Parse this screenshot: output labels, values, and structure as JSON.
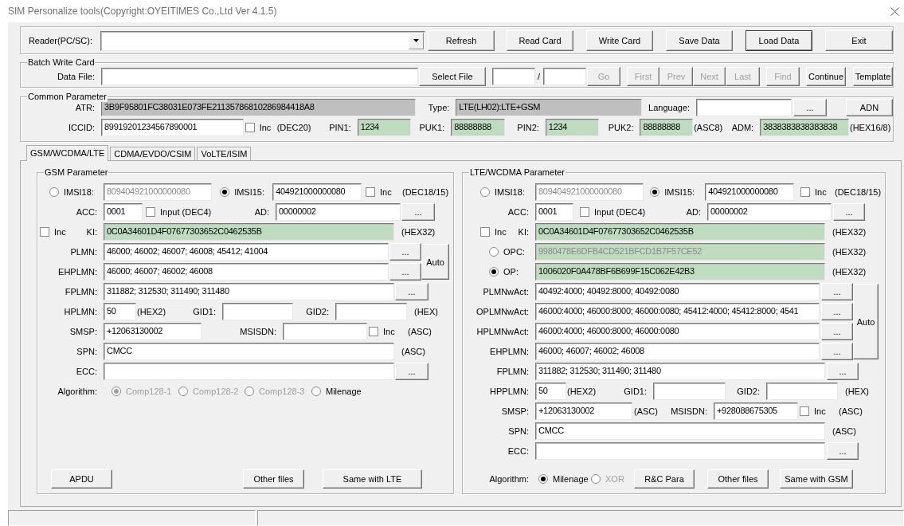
{
  "window": {
    "title": "SIM Personalize tools(Copyright:OYEITIMES Co.,Ltd Ver 4.1.5)"
  },
  "reader": {
    "rows": [
      {
        "items": [
          {
            "kind": "label",
            "text": "Reader(PC/SC):"
          },
          {
            "kind": "dropdown"
          },
          {
            "kind": "button",
            "label": "Refresh",
            "disabled": false,
            "default": false
          },
          {
            "kind": "button",
            "label": "Read Card",
            "disabled": false,
            "default": false
          },
          {
            "kind": "button",
            "label": "Write Card",
            "disabled": false,
            "default": false
          },
          {
            "kind": "button",
            "label": "Save Data",
            "disabled": false,
            "default": false
          },
          {
            "kind": "button",
            "label": "Load Data",
            "disabled": false,
            "default": true
          },
          {
            "kind": "button",
            "label": "Exit",
            "disabled": false,
            "default": false
          }
        ]
      }
    ]
  },
  "batch": {
    "legend": "Batch Write Card",
    "rows": [
      {
        "items": [
          {
            "kind": "label",
            "text": "Data File:"
          },
          {
            "kind": "field",
            "color": "#ffffff"
          },
          {
            "kind": "button",
            "label": "Select File",
            "disabled": false
          },
          {
            "kind": "field",
            "color": "#ffffff"
          },
          {
            "kind": "text",
            "text": "/"
          },
          {
            "kind": "field",
            "color": "#ffffff"
          },
          {
            "kind": "button",
            "label": "Go",
            "disabled": true
          },
          {
            "kind": "button",
            "label": "First",
            "disabled": true
          },
          {
            "kind": "button",
            "label": "Prev",
            "disabled": true
          },
          {
            "kind": "button",
            "label": "Next",
            "disabled": true
          },
          {
            "kind": "button",
            "label": "Last",
            "disabled": true
          },
          {
            "kind": "button",
            "label": "Find",
            "disabled": true
          },
          {
            "kind": "button",
            "label": "Continue",
            "disabled": false
          },
          {
            "kind": "button",
            "label": "Template",
            "disabled": false
          }
        ]
      }
    ]
  },
  "common": {
    "legend": "Common Parameter",
    "rows": [
      {
        "items": [
          {
            "kind": "label",
            "text": "ATR:"
          },
          {
            "kind": "field",
            "value": "3B9F95801FC38031E073FE21135786810286984418A8",
            "color": "#bfbfbf",
            "disabled": false
          },
          {
            "kind": "label",
            "text": "Type:"
          },
          {
            "kind": "field",
            "value": "LTE(LH02):LTE+GSM",
            "color": "#bfbfbf",
            "disabled": false
          },
          {
            "kind": "label",
            "text": "Language:"
          },
          {
            "kind": "field",
            "color": "#ffffff"
          },
          {
            "kind": "button",
            "label": "...",
            "disabled": false
          },
          {
            "kind": "button",
            "label": "ADN",
            "disabled": false
          }
        ]
      },
      {
        "items": [
          {
            "kind": "label",
            "text": "ICCID:"
          },
          {
            "kind": "field",
            "value": "89919201234567890001",
            "color": "#ffffff",
            "disabled": false
          },
          {
            "kind": "check",
            "label": "Inc",
            "checked": false
          },
          {
            "kind": "text",
            "text": "(DEC20)"
          },
          {
            "kind": "label",
            "text": "PIN1:"
          },
          {
            "kind": "field",
            "value": "1234",
            "color": "#c0dcc0",
            "disabled": false
          },
          {
            "kind": "label",
            "text": "PUK1:"
          },
          {
            "kind": "field",
            "value": "88888888",
            "color": "#c0dcc0",
            "disabled": false
          },
          {
            "kind": "label",
            "text": "PIN2:"
          },
          {
            "kind": "field",
            "value": "1234",
            "color": "#c0dcc0",
            "disabled": false
          },
          {
            "kind": "label",
            "text": "PUK2:"
          },
          {
            "kind": "field",
            "value": "88888888",
            "color": "#c0dcc0",
            "disabled": false
          },
          {
            "kind": "text",
            "text": "(ASC8)"
          },
          {
            "kind": "label",
            "text": "ADM:"
          },
          {
            "kind": "field",
            "value": "3838383838383838",
            "color": "#c0dcc0",
            "disabled": false
          },
          {
            "kind": "text",
            "text": "(HEX16/8)"
          }
        ]
      }
    ]
  },
  "tabs": [
    {
      "label": "GSM/WCDMA/LTE",
      "selected": true
    },
    {
      "label": "CDMA/EVDO/CSIM",
      "selected": false
    },
    {
      "label": "VoLTE/ISIM",
      "selected": false
    }
  ],
  "gsm": {
    "legend": "GSM Parameter",
    "rows": [
      {
        "items": [
          {
            "kind": "radio",
            "label": "IMSI18:",
            "selected": false,
            "disabled": false
          },
          {
            "kind": "field",
            "value": "809404921000000080",
            "color": "#ffffff",
            "disabled": true
          },
          {
            "kind": "radio",
            "label": "IMSI15:",
            "selected": true,
            "disabled": false
          },
          {
            "kind": "field",
            "value": "404921000000080",
            "color": "#ffffff",
            "disabled": false
          },
          {
            "kind": "check",
            "label": "Inc",
            "checked": false
          },
          {
            "kind": "text",
            "text": "(DEC18/15)"
          }
        ]
      },
      {
        "items": [
          {
            "kind": "label",
            "text": "ACC:"
          },
          {
            "kind": "field",
            "value": "0001",
            "color": "#ffffff",
            "disabled": false
          },
          {
            "kind": "check",
            "label": "Input (DEC4)",
            "checked": false
          },
          {
            "kind": "label",
            "text": "AD:"
          },
          {
            "kind": "field",
            "value": "00000002",
            "color": "#ffffff",
            "disabled": false
          },
          {
            "kind": "button",
            "label": "...",
            "disabled": false
          }
        ]
      },
      {
        "items": [
          {
            "kind": "check",
            "label": "Inc",
            "checked": false
          },
          {
            "kind": "label",
            "text": "KI:"
          },
          {
            "kind": "field",
            "value": "0C0A34601D4F07677303652C0462535B",
            "color": "#c0dcc0",
            "disabled": false
          },
          {
            "kind": "text",
            "text": "(HEX32)"
          }
        ]
      },
      {
        "kind": "stack",
        "rows": [
          {
            "items": [
              {
                "kind": "label",
                "text": "PLMN:"
              },
              {
                "kind": "field",
                "value": "46000; 46002; 46007; 46008; 45412; 41004",
                "color": "#ffffff",
                "disabled": false
              },
              {
                "kind": "button",
                "label": "...",
                "disabled": false
              }
            ]
          },
          {
            "items": [
              {
                "kind": "label",
                "text": "EHPLMN:"
              },
              {
                "kind": "field",
                "value": "46000; 46007; 46002; 46008",
                "color": "#ffffff",
                "disabled": false
              },
              {
                "kind": "button",
                "label": "...",
                "disabled": false
              }
            ]
          }
        ],
        "button": {
          "label": "Auto",
          "disabled": false
        }
      },
      {
        "items": [
          {
            "kind": "label",
            "text": "FPLMN:"
          },
          {
            "kind": "field",
            "value": "311882; 312530; 311490; 311480",
            "color": "#ffffff",
            "disabled": false
          },
          {
            "kind": "button",
            "label": "...",
            "disabled": false
          }
        ]
      },
      {
        "items": [
          {
            "kind": "label",
            "text": "HPLMN:"
          },
          {
            "kind": "field",
            "value": "50",
            "color": "#ffffff",
            "disabled": false
          },
          {
            "kind": "text",
            "text": "(HEX2)"
          },
          {
            "kind": "label",
            "text": "GID1:"
          },
          {
            "kind": "field",
            "color": "#ffffff"
          },
          {
            "kind": "label",
            "text": "GID2:"
          },
          {
            "kind": "field",
            "color": "#ffffff"
          },
          {
            "kind": "text",
            "text": "(HEX)"
          }
        ]
      },
      {
        "items": [
          {
            "kind": "label",
            "text": "SMSP:"
          },
          {
            "kind": "field",
            "value": "+12063130002",
            "color": "#ffffff",
            "disabled": false
          },
          {
            "kind": "label",
            "text": "MSISDN:"
          },
          {
            "kind": "field",
            "color": "#ffffff"
          },
          {
            "kind": "check",
            "label": "Inc",
            "checked": false
          },
          {
            "kind": "text",
            "text": "(ASC)"
          }
        ]
      },
      {
        "items": [
          {
            "kind": "label",
            "text": "SPN:"
          },
          {
            "kind": "field",
            "value": "CMCC",
            "color": "#ffffff",
            "disabled": false
          },
          {
            "kind": "text",
            "text": "(ASC)"
          }
        ]
      },
      {
        "items": [
          {
            "kind": "label",
            "text": "ECC:"
          },
          {
            "kind": "field",
            "color": "#ffffff"
          },
          {
            "kind": "button",
            "label": "...",
            "disabled": false
          }
        ]
      },
      {
        "items": [
          {
            "kind": "label",
            "text": "Algorithm:"
          },
          {
            "kind": "radio",
            "label": "Comp128-1",
            "selected": true,
            "disabled": true
          },
          {
            "kind": "radio",
            "label": "Comp128-2",
            "selected": false,
            "disabled": true
          },
          {
            "kind": "radio",
            "label": "Comp128-3",
            "selected": false,
            "disabled": true
          },
          {
            "kind": "radio",
            "label": "Milenage",
            "selected": false,
            "disabled": false
          }
        ]
      }
    ],
    "footer": [
      {
        "kind": "button",
        "label": "APDU",
        "disabled": false
      },
      {
        "kind": "button",
        "label": "Other files",
        "disabled": false
      },
      {
        "kind": "button",
        "label": "Same with LTE",
        "disabled": false
      }
    ]
  },
  "lte": {
    "legend": "LTE/WCDMA Parameter",
    "rows": [
      {
        "items": [
          {
            "kind": "radio",
            "label": "IMSI18:",
            "selected": false,
            "disabled": false
          },
          {
            "kind": "field",
            "value": "809404921000000080",
            "color": "#ffffff",
            "disabled": true
          },
          {
            "kind": "radio",
            "label": "IMSI15:",
            "selected": true,
            "disabled": false
          },
          {
            "kind": "field",
            "value": "404921000000080",
            "color": "#ffffff",
            "disabled": false
          },
          {
            "kind": "check",
            "label": "Inc",
            "checked": false
          },
          {
            "kind": "text",
            "text": "(DEC18/15)"
          }
        ]
      },
      {
        "items": [
          {
            "kind": "label",
            "text": "ACC:"
          },
          {
            "kind": "field",
            "value": "0001",
            "color": "#ffffff",
            "disabled": false
          },
          {
            "kind": "check",
            "label": "Input (DEC4)",
            "checked": false
          },
          {
            "kind": "label",
            "text": "AD:"
          },
          {
            "kind": "field",
            "value": "00000002",
            "color": "#ffffff",
            "disabled": false
          },
          {
            "kind": "button",
            "label": "...",
            "disabled": false
          }
        ]
      },
      {
        "items": [
          {
            "kind": "check",
            "label": "Inc",
            "checked": false
          },
          {
            "kind": "label",
            "text": "KI:"
          },
          {
            "kind": "field",
            "value": "0C0A34601D4F07677303652C0462535B",
            "color": "#c0dcc0",
            "disabled": false
          },
          {
            "kind": "text",
            "text": "(HEX32)"
          }
        ]
      },
      {
        "items": [
          {
            "kind": "radio",
            "label": "OPC:",
            "selected": false,
            "disabled": false
          },
          {
            "kind": "field",
            "value": "9980478E6DFB4CD521BFCD1B7F57CE52",
            "color": "#c0dcc0",
            "disabled": true
          },
          {
            "kind": "text",
            "text": "(HEX32)"
          }
        ]
      },
      {
        "items": [
          {
            "kind": "radio",
            "label": "OP:",
            "selected": true,
            "disabled": false
          },
          {
            "kind": "field",
            "value": "1006020F0A478BF6B699F15C062E42B3",
            "color": "#c0dcc0",
            "disabled": false
          },
          {
            "kind": "text",
            "text": "(HEX32)"
          }
        ]
      },
      {
        "kind": "stack",
        "rows": [
          {
            "items": [
              {
                "kind": "label",
                "text": "PLMNwAct:"
              },
              {
                "kind": "field",
                "value": "40492:4000; 40492:8000; 40492:0080",
                "color": "#ffffff",
                "disabled": false
              },
              {
                "kind": "button",
                "label": "...",
                "disabled": false
              }
            ]
          },
          {
            "items": [
              {
                "kind": "label",
                "text": "OPLMNwAct:"
              },
              {
                "kind": "field",
                "value": "46000:4000; 46000:8000; 46000:0080; 45412:4000; 45412:8000; 4541",
                "color": "#ffffff",
                "disabled": false
              },
              {
                "kind": "button",
                "label": "...",
                "disabled": false
              }
            ]
          },
          {
            "items": [
              {
                "kind": "label",
                "text": "HPLMNwAct:"
              },
              {
                "kind": "field",
                "value": "46000:4000; 46000:8000; 46000:0080",
                "color": "#ffffff",
                "disabled": false
              },
              {
                "kind": "button",
                "label": "...",
                "disabled": false
              }
            ]
          },
          {
            "items": [
              {
                "kind": "label",
                "text": "EHPLMN:"
              },
              {
                "kind": "field",
                "value": "46000; 46007; 46002; 46008",
                "color": "#ffffff",
                "disabled": false
              },
              {
                "kind": "button",
                "label": "...",
                "disabled": false
              }
            ]
          }
        ],
        "button": {
          "label": "Auto",
          "disabled": false
        }
      },
      {
        "items": [
          {
            "kind": "label",
            "text": "FPLMN:"
          },
          {
            "kind": "field",
            "value": "311882; 312530; 311490; 311480",
            "color": "#ffffff",
            "disabled": false
          },
          {
            "kind": "button",
            "label": "...",
            "disabled": false
          }
        ]
      },
      {
        "items": [
          {
            "kind": "label",
            "text": "HPPLMN:"
          },
          {
            "kind": "field",
            "value": "50",
            "color": "#ffffff",
            "disabled": false
          },
          {
            "kind": "text",
            "text": "(HEX2)"
          },
          {
            "kind": "label",
            "text": "GID1:"
          },
          {
            "kind": "field",
            "color": "#ffffff"
          },
          {
            "kind": "label",
            "text": "GID2:"
          },
          {
            "kind": "field",
            "color": "#ffffff"
          },
          {
            "kind": "text",
            "text": "(HEX)"
          }
        ]
      },
      {
        "items": [
          {
            "kind": "label",
            "text": "SMSP:"
          },
          {
            "kind": "field",
            "value": "+12063130002",
            "color": "#ffffff",
            "disabled": false
          },
          {
            "kind": "text",
            "text": "(ASC)"
          },
          {
            "kind": "label",
            "text": "MSISDN:"
          },
          {
            "kind": "field",
            "value": "+928088675305",
            "color": "#ffffff",
            "disabled": false
          },
          {
            "kind": "check",
            "label": "Inc",
            "checked": false
          },
          {
            "kind": "text",
            "text": "(ASC)"
          }
        ]
      },
      {
        "items": [
          {
            "kind": "label",
            "text": "SPN:"
          },
          {
            "kind": "field",
            "value": "CMCC",
            "color": "#ffffff",
            "disabled": false
          },
          {
            "kind": "text",
            "text": "(ASC)"
          }
        ]
      },
      {
        "items": [
          {
            "kind": "label",
            "text": "ECC:"
          },
          {
            "kind": "field",
            "color": "#ffffff"
          },
          {
            "kind": "button",
            "label": "...",
            "disabled": false
          }
        ]
      }
    ],
    "footer": [
      {
        "kind": "label",
        "text": "Algorithm:"
      },
      {
        "kind": "radio",
        "label": "Milenage",
        "selected": true,
        "disabled": false
      },
      {
        "kind": "radio",
        "label": "XOR",
        "selected": false,
        "disabled": true
      },
      {
        "kind": "button",
        "label": "R&C Para",
        "disabled": false
      },
      {
        "kind": "button",
        "label": "Other files",
        "disabled": false
      },
      {
        "kind": "button",
        "label": "Same with GSM",
        "disabled": false
      }
    ]
  }
}
